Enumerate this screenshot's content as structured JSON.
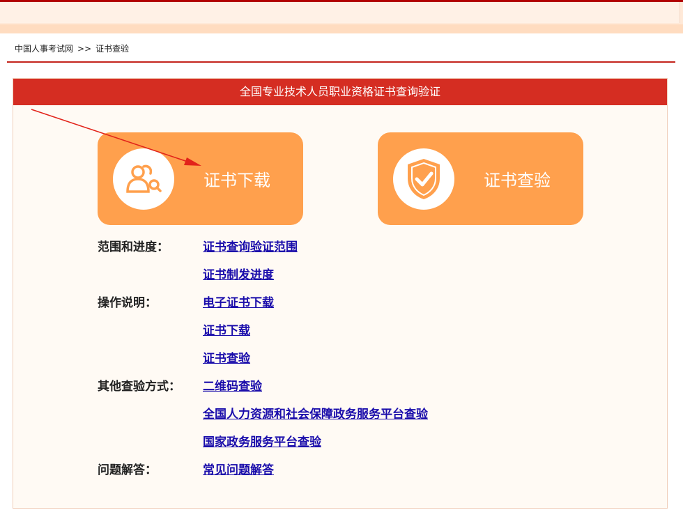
{
  "breadcrumb": {
    "home": "中国人事考试网",
    "separator": ">>",
    "current": "证书查验"
  },
  "panel": {
    "title": "全国专业技术人员职业资格证书查询验证"
  },
  "buttons": {
    "download": {
      "label": "证书下载",
      "icon": "user-search-icon"
    },
    "verify": {
      "label": "证书查验",
      "icon": "shield-check-icon"
    }
  },
  "sections": [
    {
      "label": "范围和进度：",
      "links": [
        "证书查询验证范围",
        "证书制发进度"
      ]
    },
    {
      "label": "操作说明：",
      "links": [
        "电子证书下载",
        "证书下载",
        "证书查验"
      ]
    },
    {
      "label": "其他查验方式：",
      "links": [
        "二维码查验",
        "全国人力资源和社会保障政务服务平台查验",
        "国家政务服务平台查验"
      ]
    },
    {
      "label": "问题解答：",
      "links": [
        "常见问题解答"
      ]
    }
  ],
  "colors": {
    "header_red": "#d52d22",
    "button_orange": "#ffa04d",
    "link_blue": "#1a0dab",
    "annotation_arrow": "#e2231a"
  }
}
